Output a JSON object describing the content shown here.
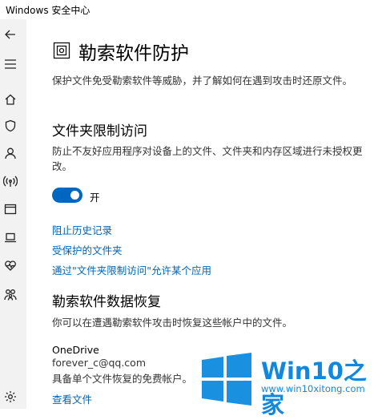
{
  "window": {
    "title": "Windows 安全中心"
  },
  "nav": {
    "items": [
      {
        "icon": "back-arrow-icon"
      },
      {
        "icon": "hamburger-menu-icon"
      },
      {
        "icon": "home-icon"
      },
      {
        "icon": "shield-icon"
      },
      {
        "icon": "person-icon"
      },
      {
        "icon": "network-wifi-icon"
      },
      {
        "icon": "app-browser-icon"
      },
      {
        "icon": "device-laptop-icon"
      },
      {
        "icon": "health-heart-icon"
      },
      {
        "icon": "family-icon"
      },
      {
        "icon": "settings-gear-icon"
      }
    ]
  },
  "page": {
    "title": "勒索软件防护",
    "description": "保护文件免受勒索软件等威胁，并了解如何在遇到攻击时还原文件。"
  },
  "cfa": {
    "heading": "文件夹限制访问",
    "desc_line1": "防止不友好应用程序对设备上的文件、文件夹和内存区域进行未授权更",
    "desc_line2": "改。",
    "toggle_state": "开",
    "toggle_on": true,
    "links": {
      "block_history": "阻止历史记录",
      "protected_folders": "受保护的文件夹",
      "allow_app": "通过\"文件夹限制访问\"允许某个应用"
    }
  },
  "recovery": {
    "heading": "勒索软件数据恢复",
    "desc": "你可以在遭遇勒索软件攻击时恢复这些帐户中的文件。",
    "service": "OneDrive",
    "account": "forever_c@qq.com",
    "plan": "具备单个文件恢复的免费帐户。",
    "view_files": "查看文件"
  },
  "watermark": {
    "brand": "Win10之家",
    "site": "www.win10xitong.com"
  },
  "colors": {
    "accent": "#0067c0",
    "link": "#0064b4",
    "nav_bg": "#f2f2f2",
    "watermark": "#1188dd"
  }
}
